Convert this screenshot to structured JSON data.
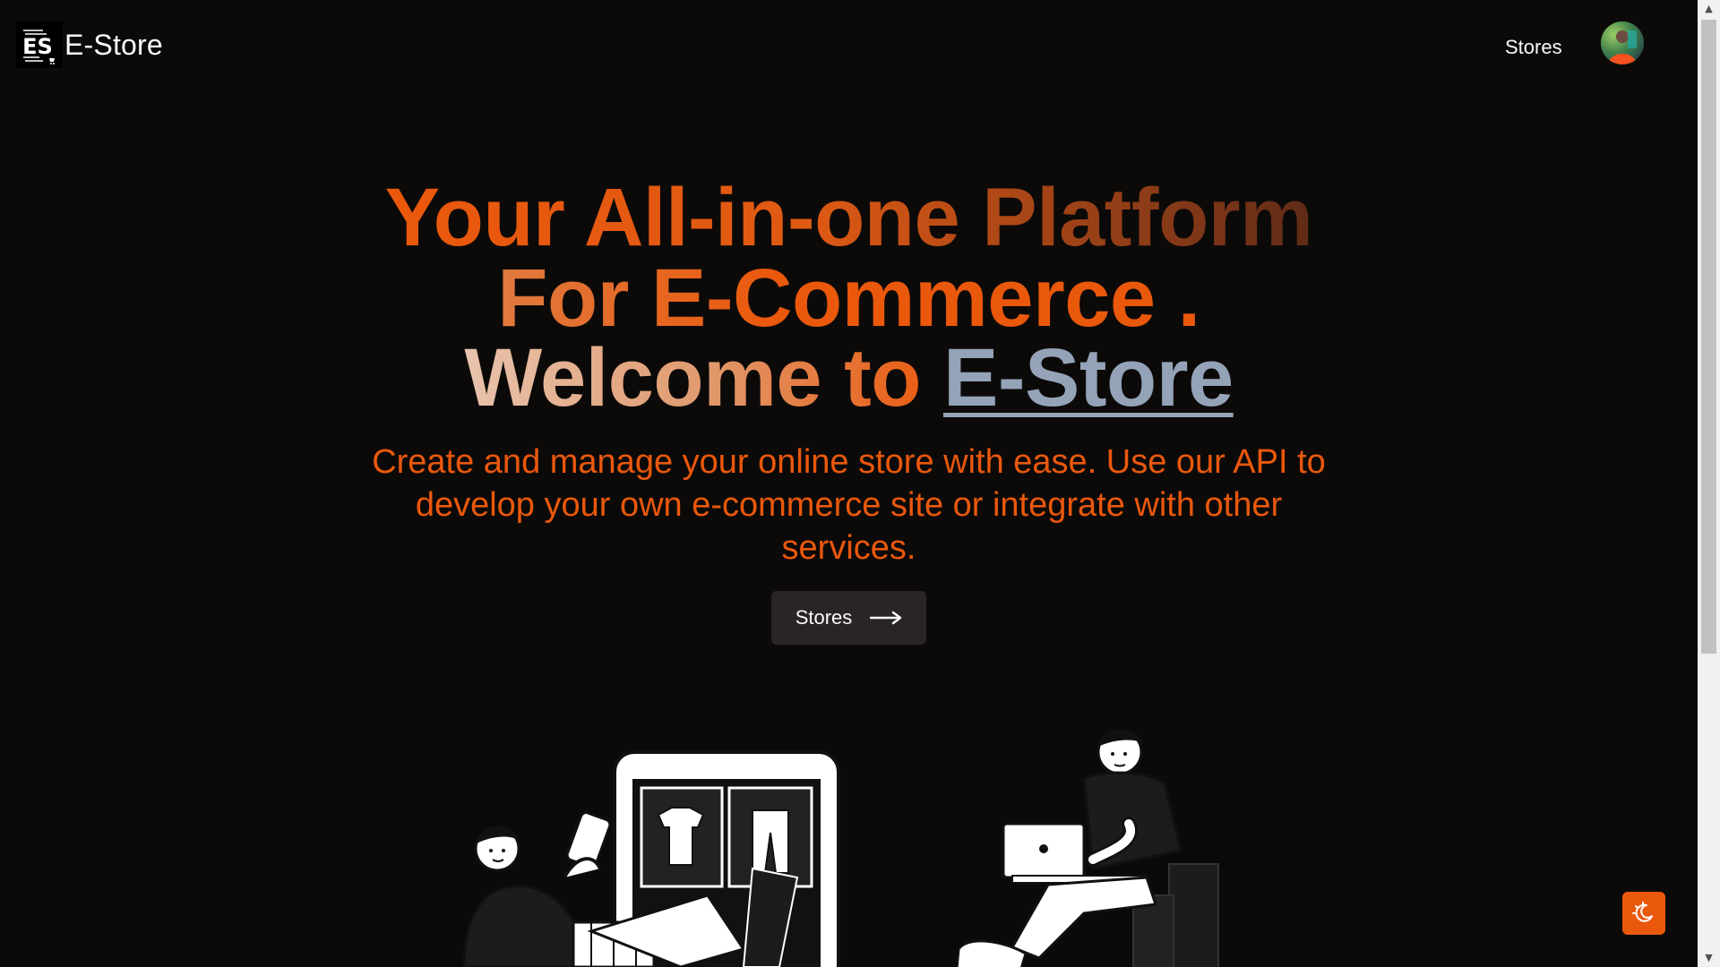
{
  "header": {
    "brand_name": "E-Store",
    "logo_text": "ES",
    "nav_stores_label": "Stores",
    "avatar_alt": "user avatar"
  },
  "hero": {
    "line1": "Your All-in-one Platform",
    "line2": "For E-Commerce .",
    "line3_prefix": "Welcome to ",
    "line3_brand": "E-Store",
    "subtitle": "Create and manage your online store with ease. Use our API to develop your own e-commerce site or integrate with other services.",
    "cta_label": "Stores"
  },
  "colors": {
    "background": "#0c0a09",
    "accent": "#ea580c",
    "brand_link": "#94a3b8",
    "button_bg": "#292524",
    "text": "#fafaf9"
  },
  "icons": {
    "cta_icon": "arrow-right-icon",
    "theme_toggle_icon": "moon-sun-icon",
    "scroll_up": "▲",
    "scroll_down": "▼"
  }
}
